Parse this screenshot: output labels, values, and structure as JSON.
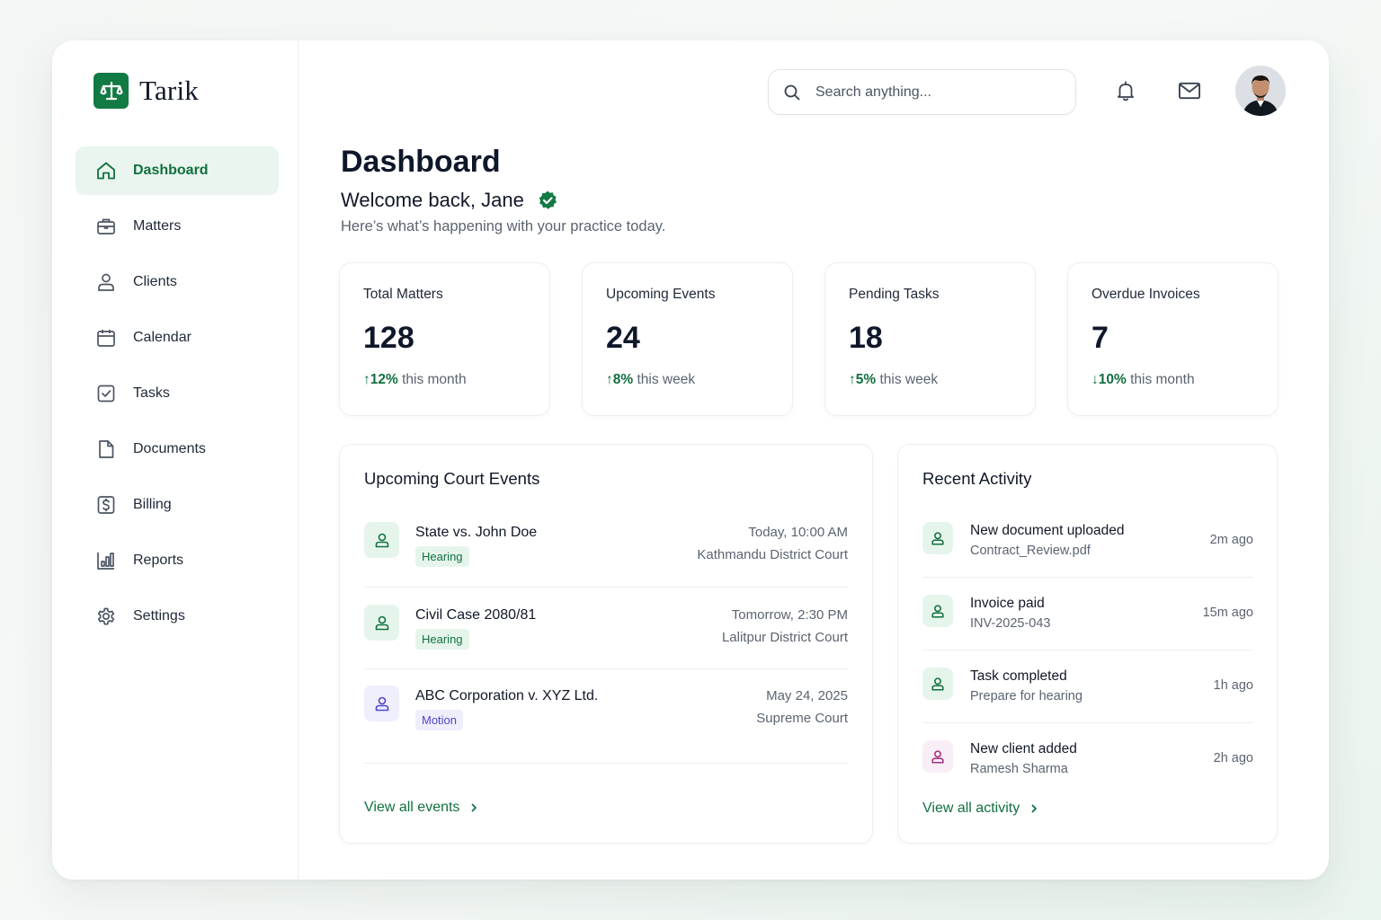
{
  "brand": {
    "name": "Tarik"
  },
  "sidebar": {
    "items": [
      {
        "label": "Dashboard",
        "icon": "home-icon",
        "active": true
      },
      {
        "label": "Matters",
        "icon": "briefcase-icon"
      },
      {
        "label": "Clients",
        "icon": "user-icon"
      },
      {
        "label": "Calendar",
        "icon": "calendar-icon"
      },
      {
        "label": "Tasks",
        "icon": "checkbox-icon"
      },
      {
        "label": "Documents",
        "icon": "document-icon"
      },
      {
        "label": "Billing",
        "icon": "dollar-icon"
      },
      {
        "label": "Reports",
        "icon": "bar-chart-icon"
      },
      {
        "label": "Settings",
        "icon": "gear-icon"
      }
    ]
  },
  "topbar": {
    "search_placeholder": "Search anything..."
  },
  "header": {
    "title": "Dashboard",
    "welcome": "Welcome back, Jane",
    "subtitle": "Here’s what’s happening with your practice today."
  },
  "stats": [
    {
      "label": "Total Matters",
      "value": "128",
      "delta": "↑12%",
      "period": " this month",
      "direction": "up"
    },
    {
      "label": "Upcoming Events",
      "value": "24",
      "delta": "↑8%",
      "period": " this week",
      "direction": "up"
    },
    {
      "label": "Pending Tasks",
      "value": "18",
      "delta": "↑5%",
      "period": " this week",
      "direction": "up"
    },
    {
      "label": "Overdue Invoices",
      "value": "7",
      "delta": "↓10%",
      "period": " this month",
      "direction": "down"
    }
  ],
  "court_events": {
    "title": "Upcoming Court Events",
    "items": [
      {
        "title": "State vs. John Doe",
        "badge": "Hearing",
        "date": "Today, 10:00 AM",
        "court": "Kathmandu District Court",
        "tone": "green"
      },
      {
        "title": "Civil Case 2080/81",
        "badge": "Hearing",
        "date": "Tomorrow, 2:30 PM",
        "court": "Lalitpur District Court",
        "tone": "green"
      },
      {
        "title": "ABC Corporation v. XYZ Ltd.",
        "badge": "Motion",
        "date": "May 24, 2025",
        "court": "Supreme Court",
        "tone": "purple"
      }
    ],
    "view_all": "View all events"
  },
  "activity": {
    "title": "Recent Activity",
    "items": [
      {
        "title": "New document uploaded",
        "sub": "Contract_Review.pdf",
        "time": "2m ago",
        "tone": "green"
      },
      {
        "title": "Invoice paid",
        "sub": "INV-2025-043",
        "time": "15m ago",
        "tone": "green"
      },
      {
        "title": "Task completed",
        "sub": "Prepare for hearing",
        "time": "1h ago",
        "tone": "green"
      },
      {
        "title": "New client added",
        "sub": "Ramesh Sharma",
        "time": "2h ago",
        "tone": "pink"
      }
    ],
    "view_all": "View all activity"
  },
  "colors": {
    "brand": "#127a43",
    "active_bg": "#e9f5ee",
    "hearing_badge_bg": "#e6f5ec",
    "motion_badge_bg": "#eeeefc",
    "client_icon_bg": "#f9eef6"
  }
}
